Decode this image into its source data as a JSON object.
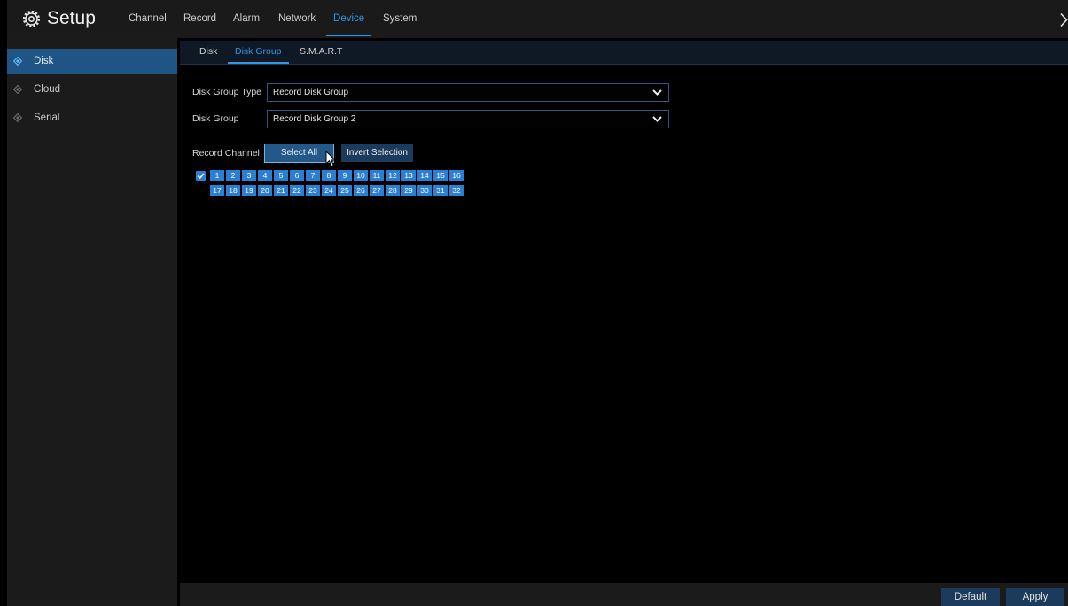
{
  "app": {
    "title": "Setup"
  },
  "icons": {
    "app": "gear-icon",
    "exit": "chevron-right-icon",
    "dropdown": "chevron-down-icon",
    "menu_bullet": "menu-bullet-icon",
    "checkbox": "checkmark-icon",
    "pointer": "mouse-cursor"
  },
  "colors": {
    "accent": "#2f96e8",
    "selected_bg": "#1f5585",
    "channel_fill": "#2b7fd2",
    "button_bg": "#1c3b5c",
    "field_border": "#2b5985"
  },
  "top_tabs": [
    {
      "label": "Channel",
      "active": false
    },
    {
      "label": "Record",
      "active": false
    },
    {
      "label": "Alarm",
      "active": false
    },
    {
      "label": "Network",
      "active": false
    },
    {
      "label": "Device",
      "active": true
    },
    {
      "label": "System",
      "active": false
    }
  ],
  "sidebar": {
    "items": [
      {
        "label": "Disk",
        "active": true
      },
      {
        "label": "Cloud",
        "active": false
      },
      {
        "label": "Serial",
        "active": false
      }
    ]
  },
  "sub_tabs": [
    {
      "label": "Disk",
      "active": false
    },
    {
      "label": "Disk Group",
      "active": true
    },
    {
      "label": "S.M.A.R.T",
      "active": false
    }
  ],
  "form": {
    "disk_group_type": {
      "label": "Disk Group Type",
      "value": "Record Disk Group"
    },
    "disk_group": {
      "label": "Disk Group",
      "value": "Record Disk Group 2"
    },
    "record_channel": {
      "label": "Record Channel",
      "select_all_label": "Select All",
      "invert_selection_label": "Invert Selection",
      "all_checked": true,
      "channels": [
        {
          "number": "1",
          "checked": true
        },
        {
          "number": "2",
          "checked": true
        },
        {
          "number": "3",
          "checked": true
        },
        {
          "number": "4",
          "checked": true
        },
        {
          "number": "5",
          "checked": true
        },
        {
          "number": "6",
          "checked": true
        },
        {
          "number": "7",
          "checked": true
        },
        {
          "number": "8",
          "checked": true
        },
        {
          "number": "9",
          "checked": true
        },
        {
          "number": "10",
          "checked": true
        },
        {
          "number": "11",
          "checked": true
        },
        {
          "number": "12",
          "checked": true
        },
        {
          "number": "13",
          "checked": true
        },
        {
          "number": "14",
          "checked": true
        },
        {
          "number": "15",
          "checked": true
        },
        {
          "number": "16",
          "checked": true
        },
        {
          "number": "17",
          "checked": true
        },
        {
          "number": "18",
          "checked": true
        },
        {
          "number": "19",
          "checked": true
        },
        {
          "number": "20",
          "checked": true
        },
        {
          "number": "21",
          "checked": true
        },
        {
          "number": "22",
          "checked": true
        },
        {
          "number": "23",
          "checked": true
        },
        {
          "number": "24",
          "checked": true
        },
        {
          "number": "25",
          "checked": true
        },
        {
          "number": "26",
          "checked": true
        },
        {
          "number": "27",
          "checked": true
        },
        {
          "number": "28",
          "checked": true
        },
        {
          "number": "29",
          "checked": true
        },
        {
          "number": "30",
          "checked": true
        },
        {
          "number": "31",
          "checked": true
        },
        {
          "number": "32",
          "checked": true
        }
      ]
    }
  },
  "footer": {
    "default_label": "Default",
    "apply_label": "Apply"
  }
}
